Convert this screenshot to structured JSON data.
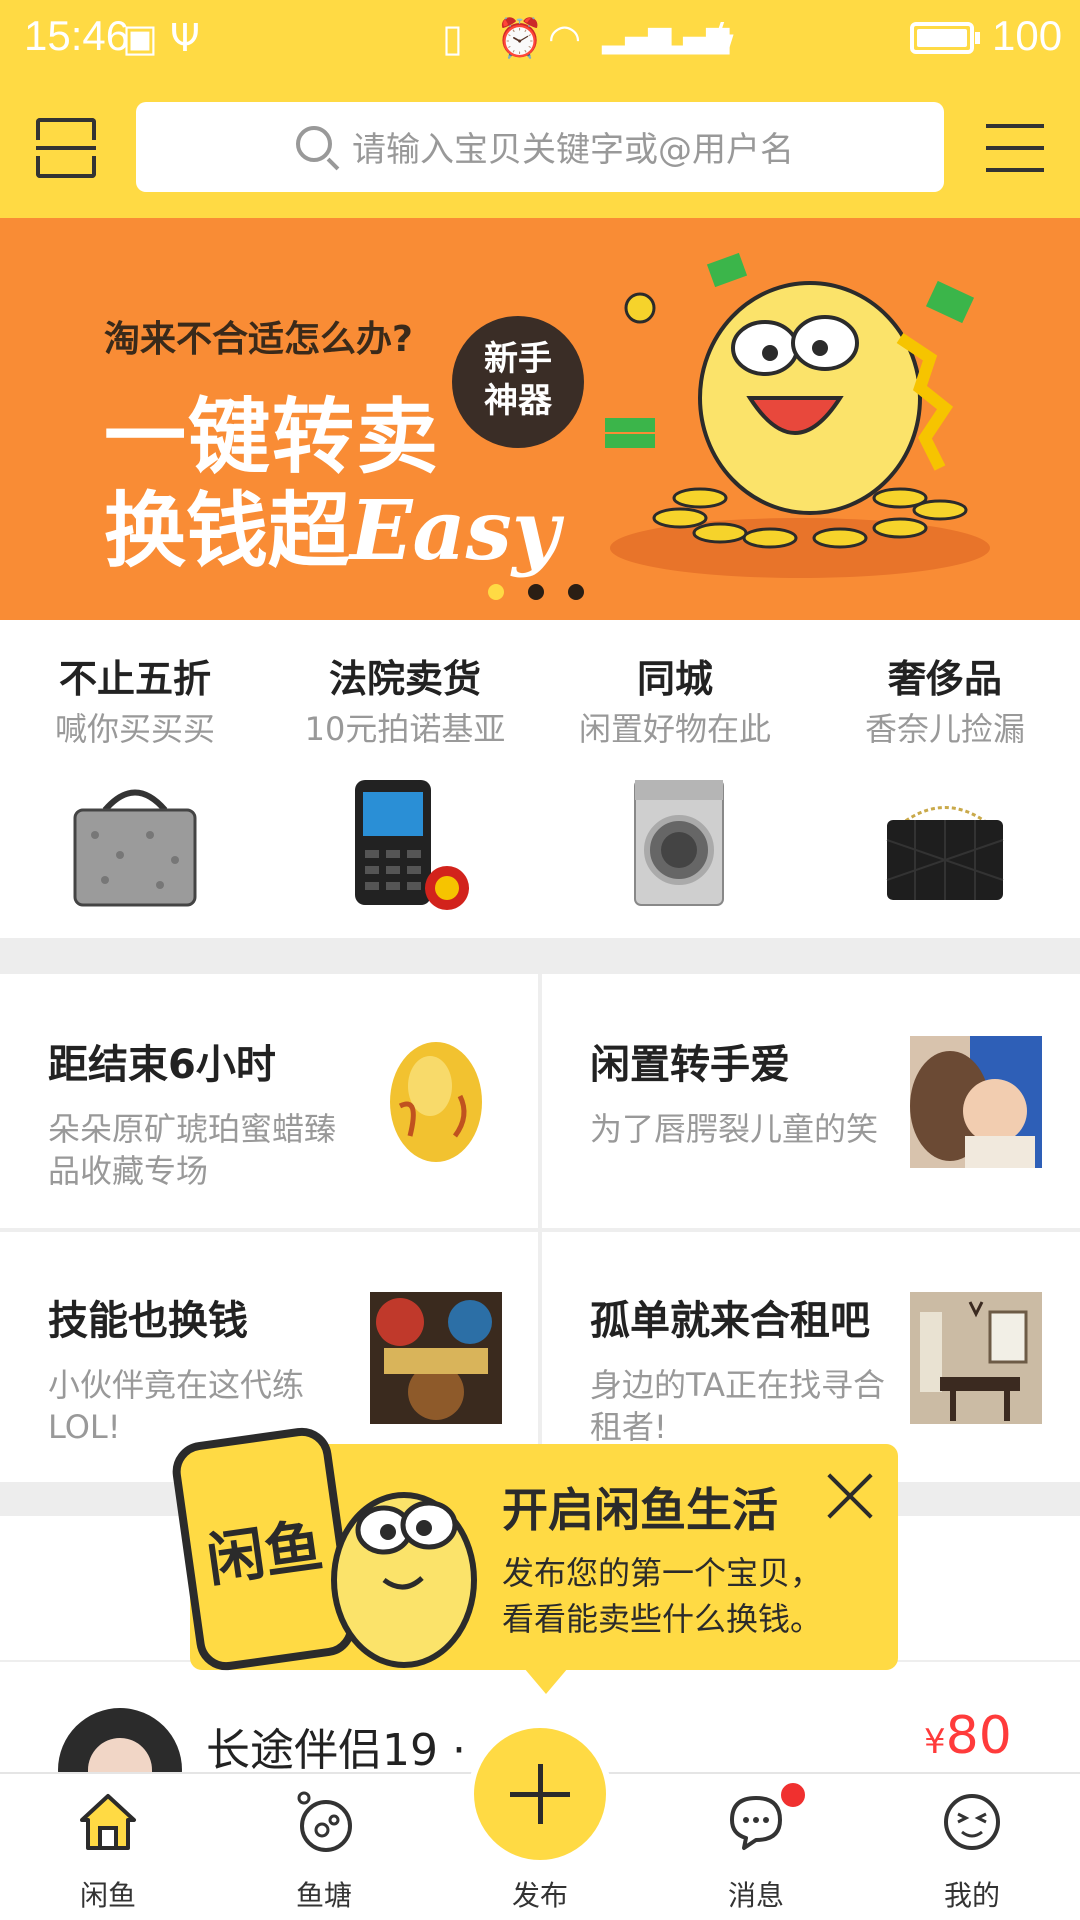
{
  "status_bar": {
    "time": "15:46",
    "battery": "100",
    "icons": [
      "image-icon",
      "usb-icon",
      "vibrate-icon",
      "alarm-icon",
      "wifi-icon",
      "4g-signal-icon",
      "signal-icon",
      "charging-icon",
      "battery-icon"
    ]
  },
  "header": {
    "search_placeholder": "请输入宝贝关键字或@用户名",
    "left_icon": "scan-icon",
    "right_icon": "menu-icon"
  },
  "banner": {
    "question": "淘来不合适怎么办?",
    "line1": "一键转卖",
    "line2_cn": "换钱超",
    "line2_en": "Easy",
    "badge_line1": "新手",
    "badge_line2": "神器",
    "active_slide": 1,
    "slide_count": 3
  },
  "categories": [
    {
      "title": "不止五折",
      "subtitle": "喊你买买买",
      "image": "handbag"
    },
    {
      "title": "法院卖货",
      "subtitle": "10元拍诺基亚",
      "image": "phone"
    },
    {
      "title": "同城",
      "subtitle": "闲置好物在此",
      "image": "washing-machine"
    },
    {
      "title": "奢侈品",
      "subtitle": "香奈儿捡漏",
      "image": "black-bag"
    }
  ],
  "cards": [
    {
      "title": "距结束6小时",
      "subtitle": "朵朵原矿琥珀蜜蜡臻品收藏专场",
      "image": "amber"
    },
    {
      "title": "闲置转手爱",
      "subtitle": "为了唇腭裂儿童的笑",
      "image": "child-photo"
    },
    {
      "title": "技能也换钱",
      "subtitle": "小伙伴竟在这代练LOL!",
      "image": "league-of-legends"
    },
    {
      "title": "孤单就来合租吧",
      "subtitle": "身边的TA正在找寻合租者!",
      "image": "room"
    }
  ],
  "tooltip": {
    "title": "开启闲鱼生活",
    "line1": "发布您的第一个宝贝，",
    "line2": "看看能卖些什么换钱。",
    "logo_text": "闲鱼"
  },
  "listing": {
    "name": "长途伴侣19 ·",
    "currency": "¥",
    "price": "80"
  },
  "tabbar": {
    "tabs": [
      {
        "label": "闲鱼",
        "icon": "home-icon"
      },
      {
        "label": "鱼塘",
        "icon": "pond-icon"
      },
      {
        "label": "发布",
        "icon": "plus-icon"
      },
      {
        "label": "消息",
        "icon": "message-icon"
      },
      {
        "label": "我的",
        "icon": "profile-icon"
      }
    ]
  },
  "colors": {
    "brand_yellow": "#FFDA44",
    "banner_orange": "#F98C35",
    "price_red": "#FF3B3B",
    "badge_red": "#F0302F"
  }
}
